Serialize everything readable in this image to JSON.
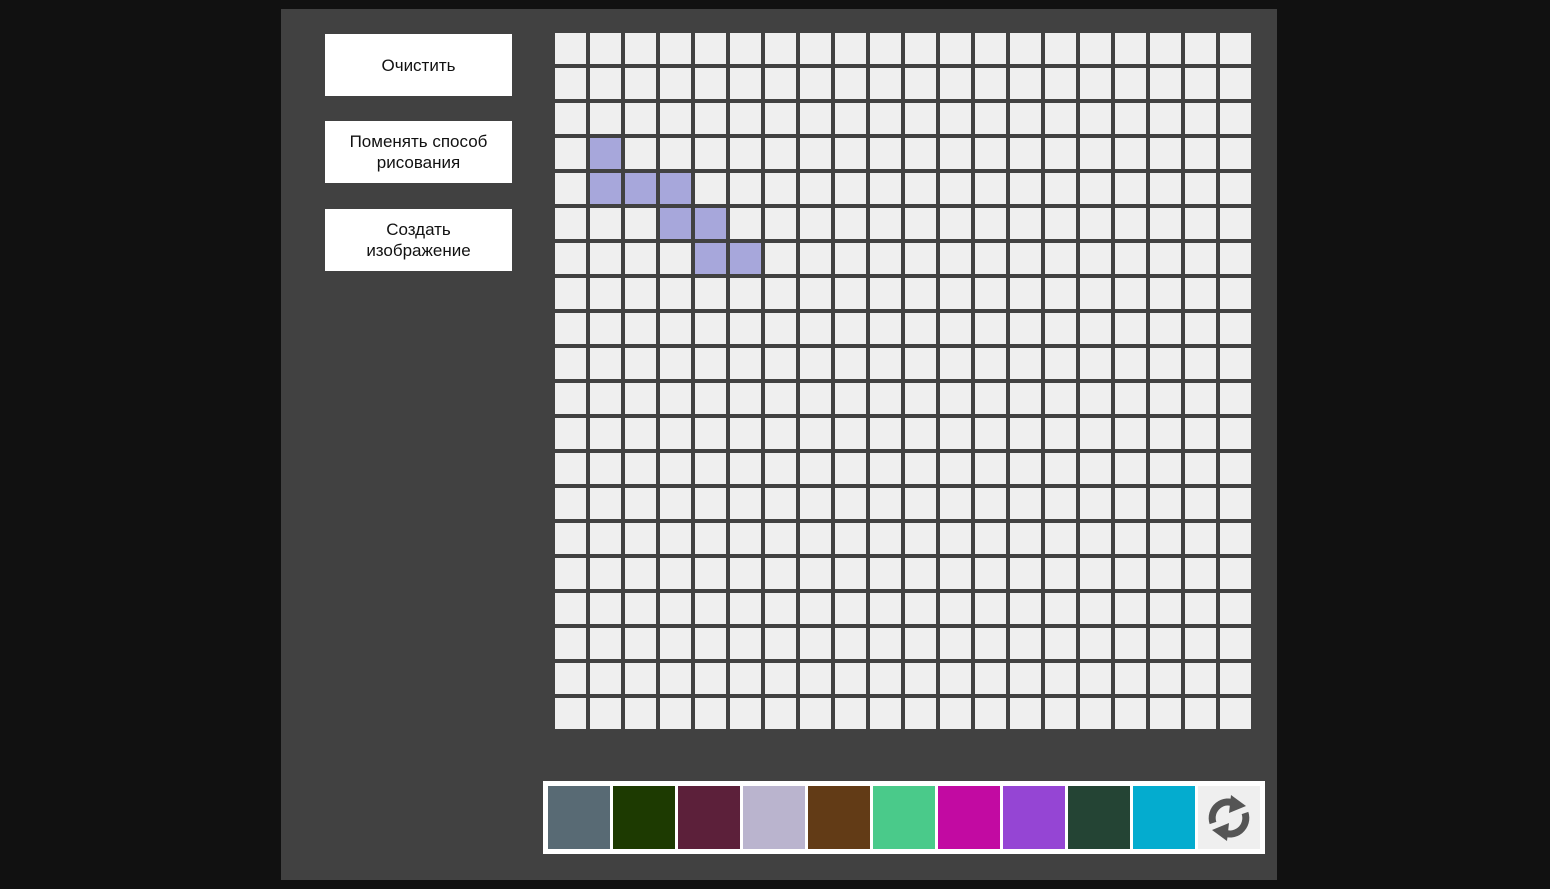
{
  "buttons": {
    "clear": "Очистить",
    "change_mode": "Поменять способ рисования",
    "create_image": "Создать изображение"
  },
  "grid": {
    "rows": 20,
    "cols": 20,
    "empty_color": "#efefef",
    "filled_color": "#a7a7db",
    "filled_cells": [
      [
        3,
        1
      ],
      [
        4,
        1
      ],
      [
        4,
        2
      ],
      [
        4,
        3
      ],
      [
        5,
        3
      ],
      [
        5,
        4
      ],
      [
        6,
        4
      ],
      [
        6,
        5
      ]
    ]
  },
  "palette": {
    "colors": [
      "#586a74",
      "#1d3a01",
      "#5c203a",
      "#bab4ce",
      "#623b16",
      "#4aca8a",
      "#c20aa2",
      "#9545d4",
      "#244434",
      "#04accf"
    ],
    "refresh_icon": "refresh-icon",
    "icon_color": "#555555"
  },
  "theme": {
    "page_bg": "#111111",
    "panel_bg": "#414141"
  }
}
